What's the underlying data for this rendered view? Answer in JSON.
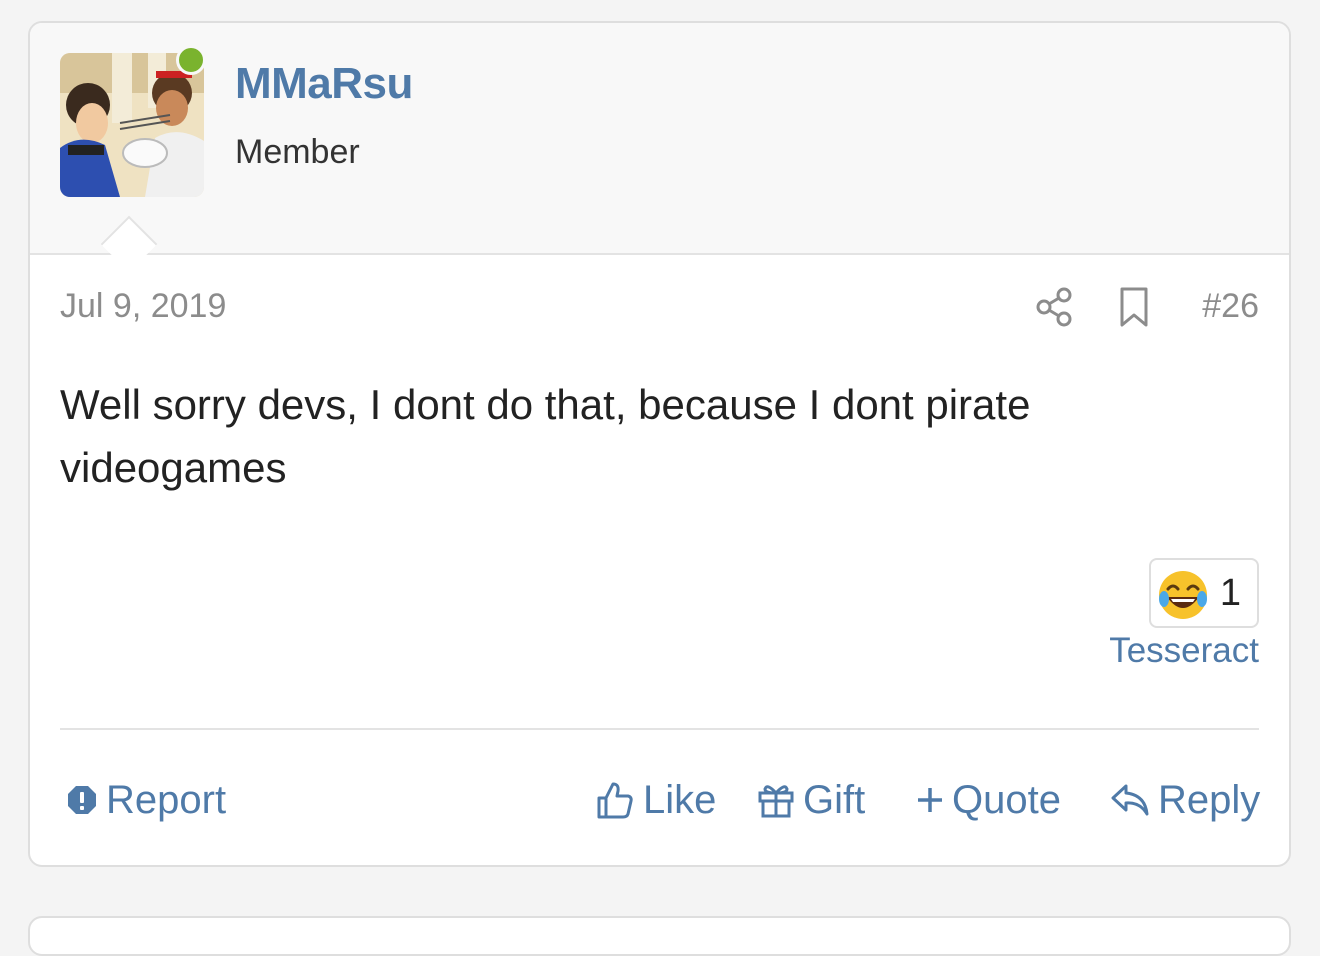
{
  "user": {
    "username": "MMaRsu",
    "title": "Member",
    "online": true
  },
  "post": {
    "date": "Jul 9, 2019",
    "number": "#26",
    "message": "Well sorry devs, I dont do that, because I dont pirate videogames"
  },
  "reactions": {
    "emoji": "laughing-tears-emoji",
    "count": "1",
    "reactor": "Tesseract"
  },
  "actions": {
    "report": "Report",
    "like": "Like",
    "gift": "Gift",
    "quote": "Quote",
    "reply": "Reply"
  },
  "colors": {
    "link": "#4f7aa8",
    "online": "#7ab32e",
    "muted": "#8c8c8c"
  }
}
